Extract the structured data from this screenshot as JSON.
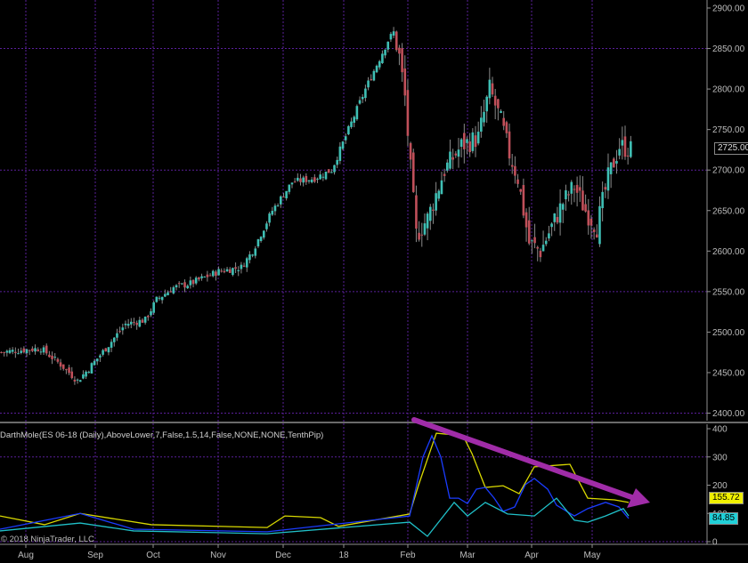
{
  "indicator_label": "DarthMole(ES 06-18 (Daily),AboveLower,7,False,1.5,14,False,NONE,NONE,TenthPip)",
  "copyright": "© 2018 NinjaTrader, LLC",
  "colors": {
    "up": "#3fbfb4",
    "down": "#c0505a",
    "grid": "#5a1f9a",
    "axis": "#909090",
    "arrow": "#a02ca8",
    "yellow": "#d8d800",
    "blue": "#1a3cff",
    "cyan": "#20c0c8",
    "green": "#0f7a10",
    "red": "#c81010"
  },
  "chart_data": [
    {
      "type": "candlestick",
      "title": "ES 06-18 (Daily)",
      "x_labels": [
        "Aug",
        "Sep",
        "Oct",
        "Nov",
        "Dec",
        "18",
        "Feb",
        "Mar",
        "Apr",
        "May"
      ],
      "y_ticks": [
        "2900.00",
        "2850.00",
        "2800.00",
        "2750.00",
        "2700.00",
        "2650.00",
        "2600.00",
        "2550.00",
        "2500.00",
        "2450.00",
        "2400.00"
      ],
      "ylim": [
        2400,
        2900
      ],
      "grid_y": [
        2850,
        2700,
        2550,
        2400
      ],
      "last_price": "2725.00",
      "bars": 212,
      "close_anchors": [
        [
          0,
          2475
        ],
        [
          15,
          2480
        ],
        [
          22,
          2460
        ],
        [
          28,
          2440
        ],
        [
          32,
          2455
        ],
        [
          38,
          2480
        ],
        [
          45,
          2510
        ],
        [
          52,
          2515
        ],
        [
          56,
          2540
        ],
        [
          62,
          2555
        ],
        [
          68,
          2560
        ],
        [
          78,
          2575
        ],
        [
          86,
          2580
        ],
        [
          90,
          2600
        ],
        [
          97,
          2650
        ],
        [
          104,
          2685
        ],
        [
          112,
          2690
        ],
        [
          118,
          2700
        ],
        [
          124,
          2750
        ],
        [
          130,
          2800
        ],
        [
          138,
          2860
        ],
        [
          140,
          2870
        ],
        [
          142,
          2840
        ],
        [
          144,
          2790
        ],
        [
          146,
          2700
        ],
        [
          148,
          2620
        ],
        [
          152,
          2640
        ],
        [
          158,
          2700
        ],
        [
          164,
          2730
        ],
        [
          170,
          2740
        ],
        [
          174,
          2800
        ],
        [
          178,
          2760
        ],
        [
          181,
          2720
        ],
        [
          184,
          2690
        ],
        [
          188,
          2610
        ],
        [
          192,
          2600
        ],
        [
          196,
          2630
        ],
        [
          200,
          2660
        ],
        [
          204,
          2680
        ],
        [
          208,
          2650
        ],
        [
          212,
          2630
        ],
        [
          216,
          2690
        ],
        [
          220,
          2730
        ],
        [
          224,
          2725
        ]
      ]
    },
    {
      "type": "line",
      "title": "DarthMole",
      "y_ticks": [
        "400",
        "300",
        "200",
        "100",
        "0"
      ],
      "ylim": [
        0,
        400
      ],
      "last_values": {
        "yellow": "155.72",
        "cyan": "84.85"
      },
      "series": [
        {
          "name": "yellow",
          "points": [
            [
              0,
              91
            ],
            [
              50,
              60
            ],
            [
              90,
              100
            ],
            [
              170,
              60
            ],
            [
              300,
              50
            ],
            [
              320,
              91
            ],
            [
              360,
              85
            ],
            [
              380,
              54
            ],
            [
              460,
              98
            ],
            [
              470,
              200
            ],
            [
              490,
              384
            ],
            [
              520,
              375
            ],
            [
              530,
              312
            ],
            [
              545,
              192
            ],
            [
              565,
              198
            ],
            [
              583,
              170
            ],
            [
              600,
              265
            ],
            [
              640,
              274
            ],
            [
              660,
              154
            ],
            [
              690,
              148
            ],
            [
              706,
              139
            ]
          ]
        },
        {
          "name": "blue",
          "points": [
            [
              0,
              44
            ],
            [
              90,
              100
            ],
            [
              150,
              44
            ],
            [
              300,
              35
            ],
            [
              460,
              91
            ],
            [
              475,
              300
            ],
            [
              485,
              375
            ],
            [
              495,
              300
            ],
            [
              505,
              154
            ],
            [
              515,
              154
            ],
            [
              525,
              135
            ],
            [
              535,
              186
            ],
            [
              545,
              192
            ],
            [
              555,
              154
            ],
            [
              565,
              107
            ],
            [
              578,
              123
            ],
            [
              590,
              202
            ],
            [
              600,
              224
            ],
            [
              615,
              186
            ],
            [
              625,
              129
            ],
            [
              645,
              91
            ],
            [
              660,
              117
            ],
            [
              680,
              139
            ],
            [
              695,
              123
            ],
            [
              706,
              82
            ]
          ]
        },
        {
          "name": "cyan",
          "points": [
            [
              0,
              38
            ],
            [
              90,
              66
            ],
            [
              150,
              38
            ],
            [
              300,
              28
            ],
            [
              460,
              69
            ],
            [
              480,
              19
            ],
            [
              510,
              139
            ],
            [
              525,
              91
            ],
            [
              545,
              139
            ],
            [
              570,
              98
            ],
            [
              600,
              91
            ],
            [
              625,
              154
            ],
            [
              645,
              76
            ],
            [
              660,
              69
            ],
            [
              680,
              91
            ],
            [
              700,
              117
            ],
            [
              706,
              91
            ]
          ]
        }
      ],
      "annotation": "downtrend-arrow"
    }
  ]
}
